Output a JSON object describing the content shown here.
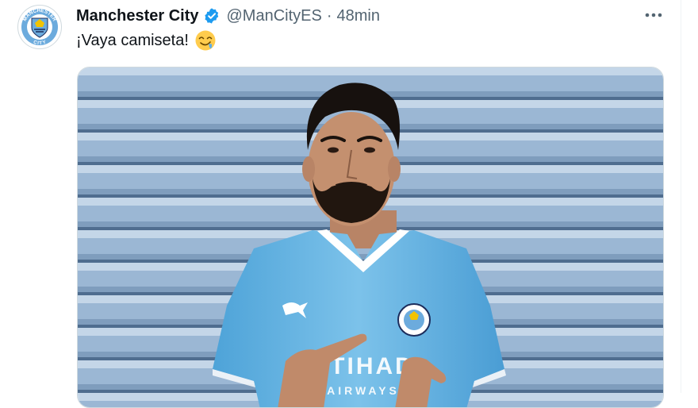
{
  "tweet": {
    "display_name": "Manchester City",
    "handle": "@ManCityES",
    "separator": "·",
    "time": "48min",
    "text": "¡Vaya camiseta!",
    "emoji": "drooling-face"
  },
  "avatar": {
    "logo": "manchester-city-crest",
    "logo_text": "MANCHESTER CITY"
  },
  "icons": {
    "verified": "verified-badge-icon",
    "more": "more-options-icon"
  },
  "media": {
    "description_icon": "photo",
    "shirt_sponsor_text": "ETIHAD AIRWAYS",
    "kit_brand": "puma"
  },
  "colors": {
    "verified": "#1d9bf0",
    "text_secondary": "#536471",
    "shutter": "#9bb7d4",
    "jersey": "#6cb8e4"
  }
}
